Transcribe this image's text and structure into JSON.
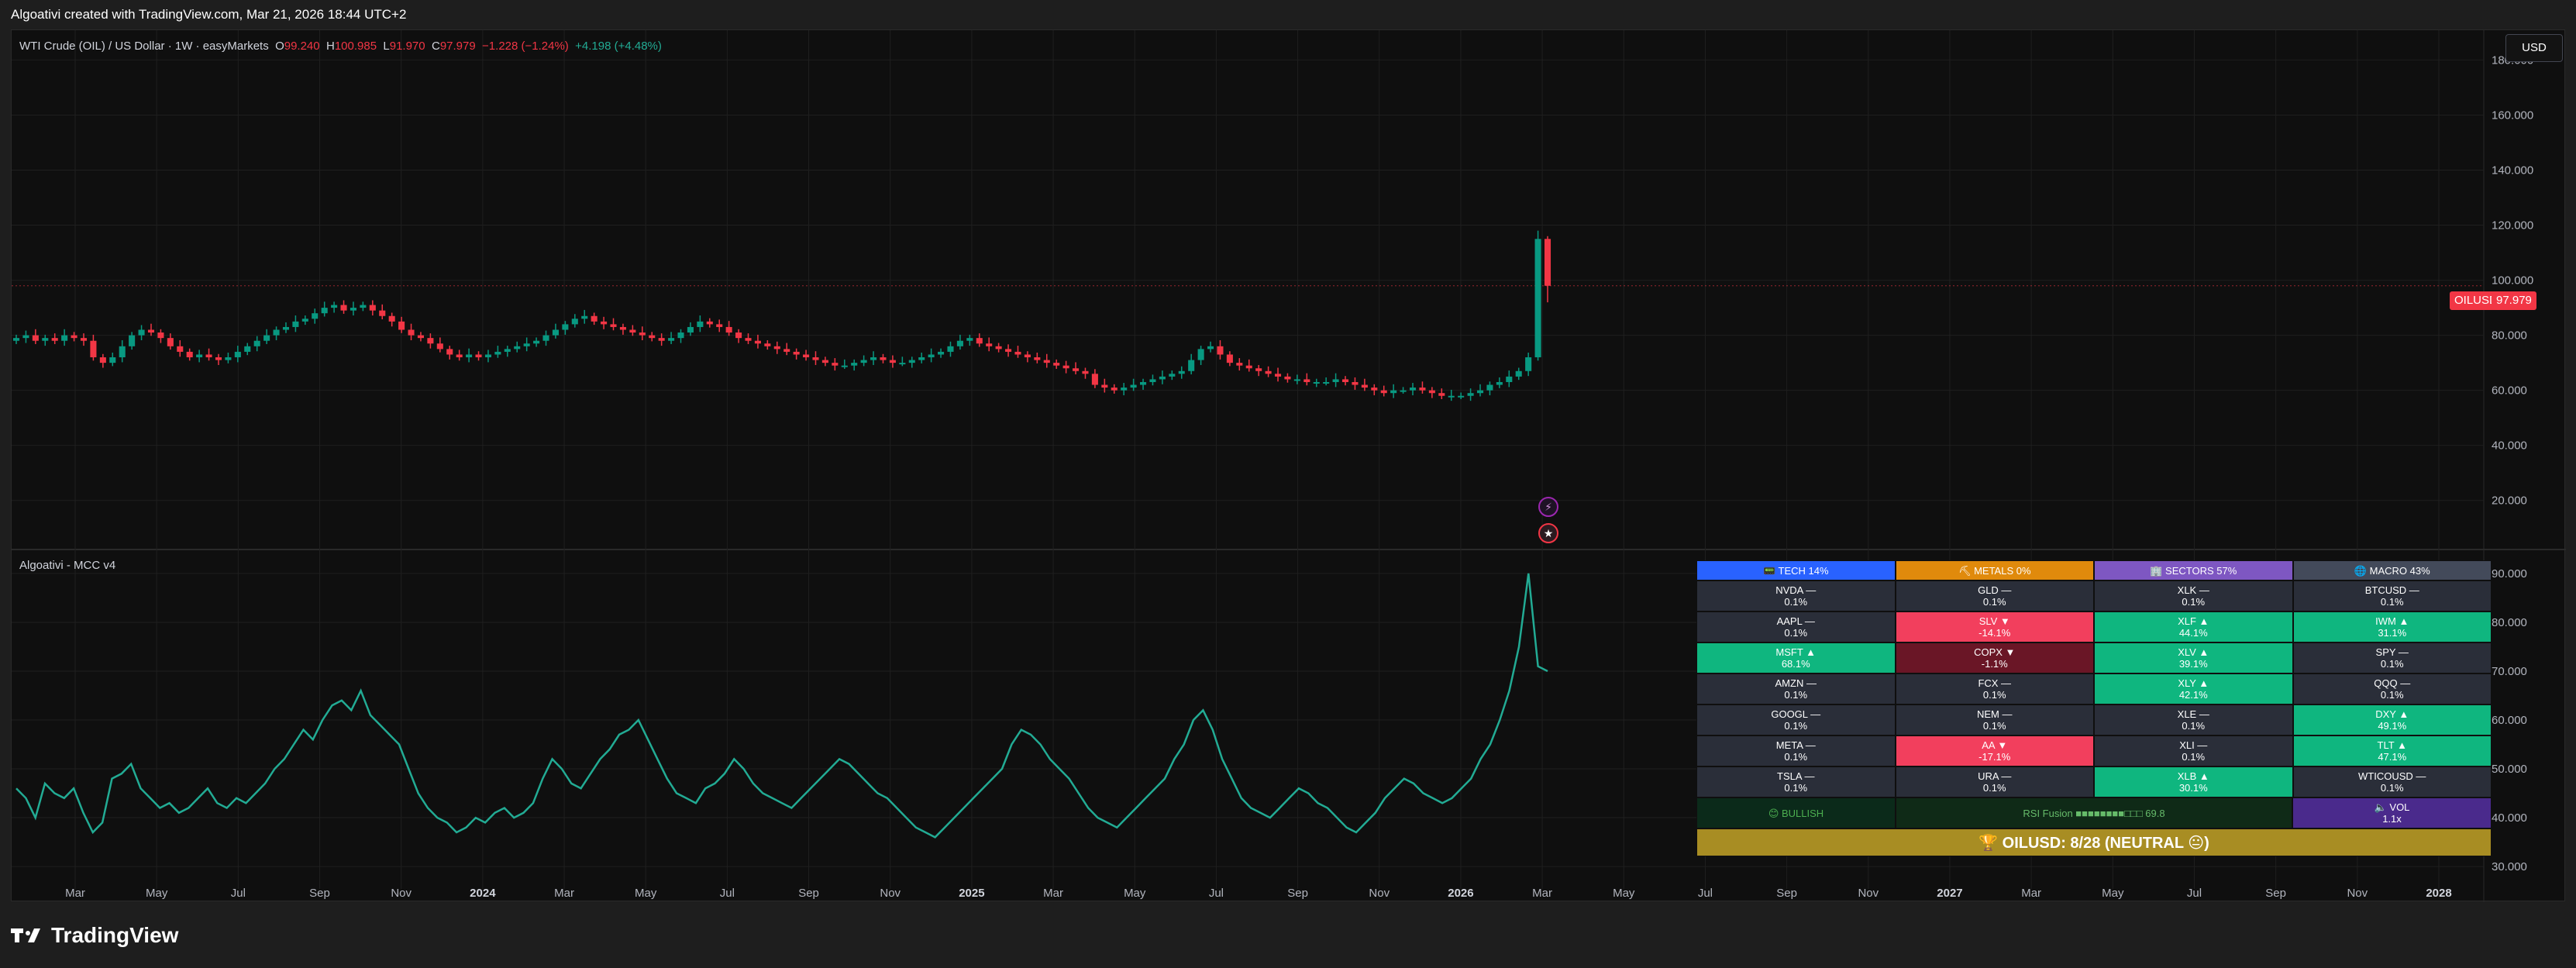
{
  "header": {
    "created_text": "Algoativi created with TradingView.com, Mar 21, 2026 18:44 UTC+2"
  },
  "symbol": {
    "name": "WTI Crude (OIL) / US Dollar · 1W · easyMarkets",
    "o_label": "O",
    "o": "99.240",
    "h_label": "H",
    "h": "100.985",
    "l_label": "L",
    "l": "91.970",
    "c_label": "C",
    "c": "97.979",
    "chg": "−1.228 (−1.24%)",
    "extra": "+4.198 (+4.48%)"
  },
  "currency_button": "USD",
  "price_tag": {
    "ticker": "OILUSD",
    "price": "97.979"
  },
  "indicator": {
    "title": "Algoativi - MCC v4"
  },
  "colors": {
    "up": "#089981",
    "down": "#f23645",
    "line": "#22ab94",
    "grid": "#1f1f1f"
  },
  "icons": {
    "event1": "lightning-icon",
    "event2": "us-flag-icon"
  },
  "chart_data": [
    {
      "type": "candlestick",
      "title": "",
      "x_ticks": [
        "Mar",
        "May",
        "Jul",
        "Sep",
        "Nov",
        "2024",
        "Mar",
        "May",
        "Jul",
        "Sep",
        "Nov",
        "2025",
        "Mar",
        "May",
        "Jul",
        "Sep",
        "Nov",
        "2026",
        "Mar",
        "May",
        "Jul",
        "Sep",
        "Nov",
        "2027",
        "Mar",
        "May",
        "Jul",
        "Sep",
        "Nov",
        "2028"
      ],
      "y_ticks": [
        "180.000",
        "160.000",
        "140.000",
        "120.000",
        "100.000",
        "80.000",
        "60.000",
        "40.000",
        "20.000"
      ],
      "ylim": [
        5,
        188
      ],
      "last_price": 97.979,
      "closes": [
        79,
        80,
        78,
        79,
        78,
        80,
        79,
        78,
        72,
        70,
        72,
        76,
        80,
        82,
        81,
        79,
        76,
        74,
        72,
        73,
        72,
        71,
        72,
        74,
        76,
        78,
        80,
        82,
        83,
        85,
        86,
        88,
        90,
        91,
        89,
        90,
        91,
        89,
        87,
        85,
        82,
        80,
        79,
        77,
        75,
        73,
        72,
        73,
        72,
        73,
        74,
        75,
        76,
        77,
        78,
        80,
        82,
        84,
        86,
        87,
        85,
        84,
        83,
        82,
        81,
        80,
        79,
        78,
        79,
        81,
        83,
        85,
        84,
        83,
        81,
        79,
        78,
        77,
        76,
        75,
        74,
        73,
        72,
        71,
        70,
        69,
        69,
        70,
        71,
        72,
        71,
        70,
        70,
        71,
        72,
        73,
        74,
        76,
        78,
        79,
        77,
        76,
        75,
        74,
        73,
        72,
        71,
        70,
        69,
        68,
        67,
        66,
        62,
        61,
        60,
        61,
        62,
        63,
        64,
        65,
        66,
        67,
        71,
        75,
        76,
        73,
        70,
        69,
        68,
        67,
        66,
        65,
        64,
        64,
        63,
        63,
        63,
        64,
        63,
        62,
        61,
        60,
        59,
        60,
        60,
        61,
        60,
        59,
        58,
        58,
        58,
        59,
        60,
        62,
        63,
        65,
        67,
        72,
        115,
        99
      ],
      "first_year": "2023"
    },
    {
      "type": "line",
      "title": "Algoativi - MCC v4",
      "y_ticks": [
        "90.000",
        "80.000",
        "70.000",
        "60.000",
        "50.000",
        "40.000",
        "30.000"
      ],
      "ylim": [
        27,
        93
      ],
      "values": [
        46,
        44,
        40,
        47,
        45,
        44,
        46,
        41,
        37,
        39,
        48,
        49,
        51,
        46,
        44,
        42,
        43,
        41,
        42,
        44,
        46,
        43,
        42,
        44,
        43,
        45,
        47,
        50,
        52,
        55,
        58,
        56,
        60,
        63,
        64,
        62,
        66,
        61,
        59,
        57,
        55,
        50,
        45,
        42,
        40,
        39,
        37,
        38,
        40,
        39,
        41,
        42,
        40,
        41,
        43,
        48,
        52,
        50,
        47,
        46,
        49,
        52,
        54,
        57,
        58,
        60,
        56,
        52,
        48,
        45,
        44,
        43,
        46,
        47,
        49,
        52,
        50,
        47,
        45,
        44,
        43,
        42,
        44,
        46,
        48,
        50,
        52,
        51,
        49,
        47,
        45,
        44,
        42,
        40,
        38,
        37,
        36,
        38,
        40,
        42,
        44,
        46,
        48,
        50,
        55,
        58,
        57,
        55,
        52,
        50,
        48,
        45,
        42,
        40,
        39,
        38,
        40,
        42,
        44,
        46,
        48,
        52,
        55,
        60,
        62,
        58,
        52,
        48,
        44,
        42,
        41,
        40,
        42,
        44,
        46,
        45,
        43,
        42,
        40,
        38,
        37,
        39,
        41,
        44,
        46,
        48,
        47,
        45,
        44,
        43,
        44,
        46,
        48,
        52,
        55,
        60,
        66,
        75,
        90,
        71,
        70
      ],
      "first_year": "2023"
    }
  ],
  "dashboard": {
    "headers": [
      "📟 TECH 14%",
      "⛏ METALS 0%",
      "🏢 SECTORS 57%",
      "🌐 MACRO 43%"
    ],
    "rows": [
      [
        {
          "t": "NVDA —",
          "v": "0.1%",
          "c": "neutral"
        },
        {
          "t": "GLD —",
          "v": "0.1%",
          "c": "neutral"
        },
        {
          "t": "XLK —",
          "v": "0.1%",
          "c": "neutral"
        },
        {
          "t": "BTCUSD —",
          "v": "0.1%",
          "c": "neutral"
        }
      ],
      [
        {
          "t": "AAPL —",
          "v": "0.1%",
          "c": "neutral"
        },
        {
          "t": "SLV ▼",
          "v": "-14.1%",
          "c": "red"
        },
        {
          "t": "XLF ▲",
          "v": "44.1%",
          "c": "green"
        },
        {
          "t": "IWM ▲",
          "v": "31.1%",
          "c": "green"
        }
      ],
      [
        {
          "t": "MSFT ▲",
          "v": "68.1%",
          "c": "green"
        },
        {
          "t": "COPX ▼",
          "v": "-1.1%",
          "c": "darkred"
        },
        {
          "t": "XLV ▲",
          "v": "39.1%",
          "c": "green"
        },
        {
          "t": "SPY —",
          "v": "0.1%",
          "c": "neutral"
        }
      ],
      [
        {
          "t": "AMZN —",
          "v": "0.1%",
          "c": "neutral"
        },
        {
          "t": "FCX —",
          "v": "0.1%",
          "c": "neutral"
        },
        {
          "t": "XLY ▲",
          "v": "42.1%",
          "c": "green"
        },
        {
          "t": "QQQ —",
          "v": "0.1%",
          "c": "neutral"
        }
      ],
      [
        {
          "t": "GOOGL —",
          "v": "0.1%",
          "c": "neutral"
        },
        {
          "t": "NEM —",
          "v": "0.1%",
          "c": "neutral"
        },
        {
          "t": "XLE —",
          "v": "0.1%",
          "c": "neutral"
        },
        {
          "t": "DXY ▲",
          "v": "49.1%",
          "c": "green"
        }
      ],
      [
        {
          "t": "META —",
          "v": "0.1%",
          "c": "neutral"
        },
        {
          "t": "AA ▼",
          "v": "-17.1%",
          "c": "red"
        },
        {
          "t": "XLI —",
          "v": "0.1%",
          "c": "neutral"
        },
        {
          "t": "TLT ▲",
          "v": "47.1%",
          "c": "green"
        }
      ],
      [
        {
          "t": "TSLA —",
          "v": "0.1%",
          "c": "neutral"
        },
        {
          "t": "URA —",
          "v": "0.1%",
          "c": "neutral"
        },
        {
          "t": "XLB ▲",
          "v": "30.1%",
          "c": "green"
        },
        {
          "t": "WTICOUSD —",
          "v": "0.1%",
          "c": "neutral"
        }
      ]
    ],
    "bottom": {
      "bullish": "😊 BULLISH",
      "rsi": "RSI Fusion ■■■■■■■■□□□ 69.8",
      "vol": "🔈 VOL",
      "vol_value": "1.1x"
    },
    "final": "🏆 OILUSD: 8/28 (NEUTRAL 😐)"
  },
  "logo_text": "TradingView"
}
